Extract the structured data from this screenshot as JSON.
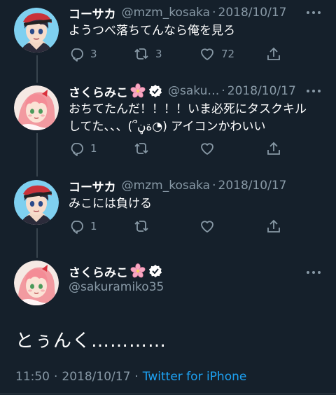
{
  "tweets": [
    {
      "name": "コーサカ",
      "handle": "@mzm_kosaka",
      "date": "2018/10/17",
      "text": "ようつべ落ちてんなら俺を見ろ",
      "replies": "3",
      "retweets": "3",
      "likes": "72"
    },
    {
      "name": "さくらみこ",
      "handle": "@saku…",
      "date": "2018/10/17",
      "text": "おちてたんだ！！！！いま必死にタスクキル\nしてた、、、(՞ةڼ◔) アイコンかわいい",
      "replies": "1",
      "retweets": "",
      "likes": ""
    },
    {
      "name": "コーサカ",
      "handle": "@mzm_kosaka",
      "date": "2018/10/17",
      "text": "みこには負ける",
      "replies": "1",
      "retweets": "",
      "likes": ""
    }
  ],
  "main_tweet": {
    "name": "さくらみこ",
    "handle": "@sakuramiko35",
    "text": "とぅんく…………",
    "time": "11:50",
    "date": "2018/10/17",
    "source": "Twitter for iPhone"
  },
  "separator": "·",
  "icons": [
    "more-icon",
    "reply-icon",
    "retweet-icon",
    "like-icon",
    "share-icon",
    "verified-icon",
    "sakura-emoji-icon"
  ],
  "colors": {
    "background": "#15202b",
    "secondary_text": "#8899a6",
    "link": "#1da1f2",
    "thread_line": "#38444d"
  }
}
